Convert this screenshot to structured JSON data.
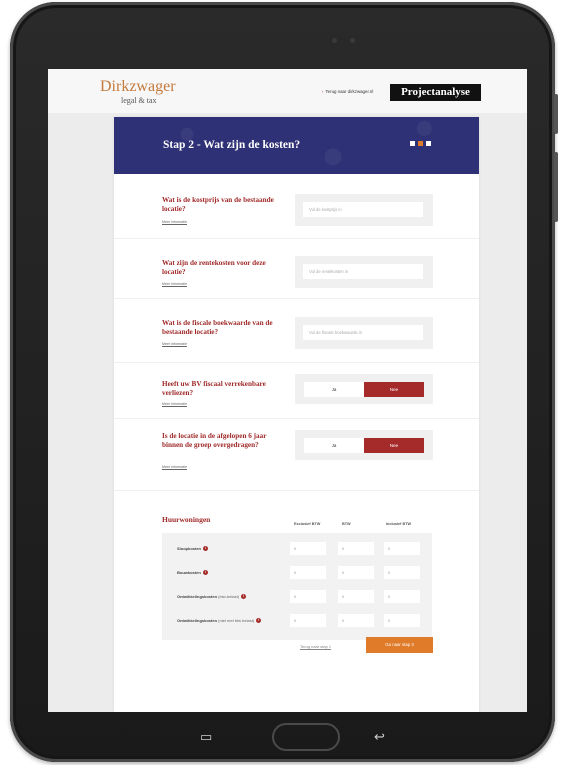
{
  "header": {
    "logo_name": "Dirkzwager",
    "logo_sub": "legal & tax",
    "back_link": "Terug naar dirkzwager.nl",
    "badge": "Projectanalyse"
  },
  "banner": {
    "title": "Stap 2 - Wat zijn de kosten?",
    "steps": [
      {
        "state": "done",
        "color": "#ffffff"
      },
      {
        "state": "current",
        "color": "#e07b2a"
      },
      {
        "state": "todo",
        "color": "#ffffff"
      }
    ]
  },
  "questions": [
    {
      "title": "Wat is de kostprijs van de bestaande locatie?",
      "more": "Meer informatie",
      "placeholder": "Vul de kostprijs in"
    },
    {
      "title": "Wat zijn de rentekosten voor deze locatie?",
      "more": "Meer informatie",
      "placeholder": "Vul de rentekosten in"
    },
    {
      "title": "Wat is de fiscale boekwaarde van de bestaande locatie?",
      "more": "Meer informatie",
      "placeholder": "Vul de fiscale boekwaarde in"
    },
    {
      "title": "Heeft uw BV fiscaal verrekenbare verliezen?",
      "more": "Meer informatie",
      "options": [
        "Ja",
        "Nee"
      ],
      "selected": "Nee"
    },
    {
      "title": "Is de locatie in de afgelopen 6 jaar binnen de groep overgedragen?",
      "more": "Meer informatie",
      "options": [
        "Ja",
        "Nee"
      ],
      "selected": "Nee"
    }
  ],
  "huur": {
    "title": "Huurwoningen",
    "columns": [
      "Exclusief BTW",
      "BTW",
      "Inclusief BTW"
    ],
    "rows": [
      {
        "label": "Sloopkosten",
        "sub": "",
        "values": [
          "0",
          "0",
          "0"
        ]
      },
      {
        "label": "Bouwkosten",
        "sub": "",
        "values": [
          "0",
          "0",
          "0"
        ]
      },
      {
        "label": "Ontwikkelingskosten",
        "sub": "(btw-belast)",
        "values": [
          "0",
          "0",
          "0"
        ]
      },
      {
        "label": "Ontwikkelingskosten",
        "sub": "(niet met btw belast)",
        "values": [
          "0",
          "0",
          "0"
        ]
      }
    ]
  },
  "footer": {
    "back": "Terug naar stap 1",
    "next": "Ga naar stap 3"
  },
  "colors": {
    "accent": "#a52a2a",
    "orange": "#e07b2a",
    "banner": "#2e3175"
  }
}
